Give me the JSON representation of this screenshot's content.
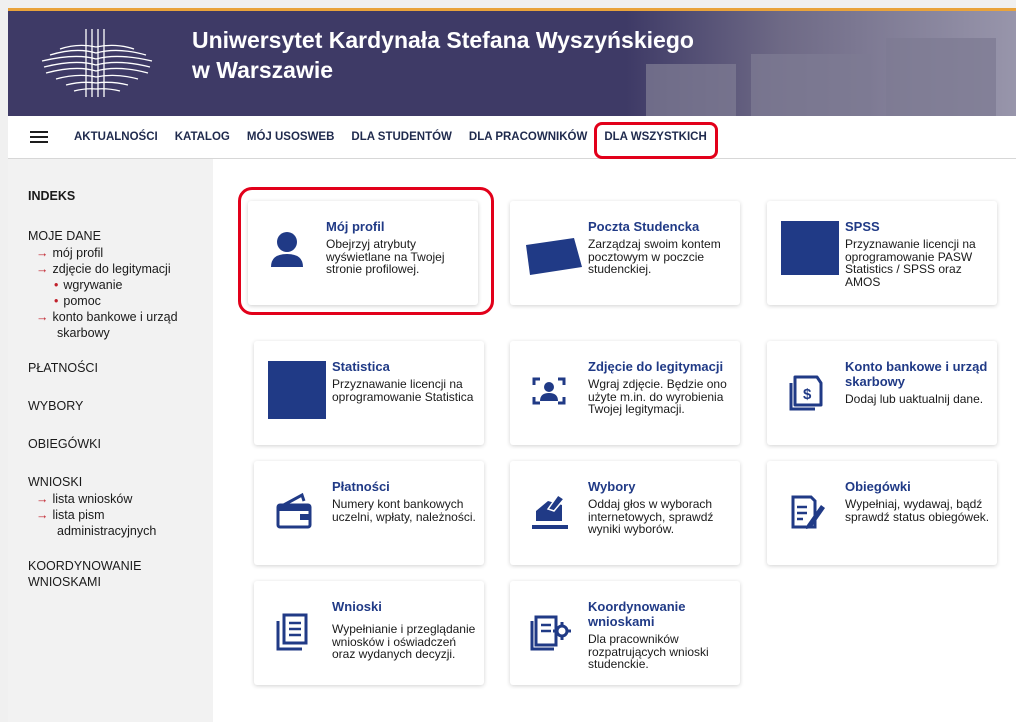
{
  "header": {
    "title": "Uniwersytet Kardynała Stefana Wyszyńskiego w Warszawie",
    "logo_icon": "university-logo-icon",
    "colors": {
      "banner": "#3e3a66",
      "accent": "#e9a33b",
      "highlight": "#e2001a",
      "link": "#203a86"
    }
  },
  "nav": {
    "menu_icon": "hamburger-menu-icon",
    "items": [
      "AKTUALNOŚCI",
      "KATALOG",
      "MÓJ USOSWEB",
      "DLA STUDENTÓW",
      "DLA PRACOWNIKÓW",
      "DLA WSZYSTKICH"
    ],
    "active": "DLA WSZYSTKICH"
  },
  "sidebar": {
    "heading": "INDEKS",
    "moje_dane": {
      "label": "MOJE DANE",
      "links": [
        "mój profil",
        "zdjęcie do legitymacji"
      ],
      "sub": [
        "wgrywanie",
        "pomoc"
      ],
      "konto_line1": "konto bankowe i urząd",
      "konto_line2": "skarbowy"
    },
    "platnosci": "PŁATNOŚCI",
    "wybory": "WYBORY",
    "obiegowki": "OBIEGÓWKI",
    "wnioski": {
      "label": "WNIOSKI",
      "link1": "lista wniosków",
      "link2_line1": "lista pism",
      "link2_line2": "administracyjnych"
    },
    "koordynowanie_line1": "KOORDYNOWANIE",
    "koordynowanie_line2": "WNIOSKAMI"
  },
  "cards": [
    {
      "title": "Mój profil",
      "desc": "Obejrzyj atrybuty wyświetlane na Twojej stronie profilowej.",
      "icon": "user-icon"
    },
    {
      "title": "Poczta Studencka",
      "desc": "Zarządzaj swoim kontem pocztowym w poczcie studenckiej.",
      "icon": "mail-logo-icon"
    },
    {
      "title": "SPSS",
      "desc": "Przyznawanie licencji na oprogramowanie PASW Statistics / SPSS oraz AMOS",
      "icon": "spss-logo-icon"
    },
    {
      "title": "Statistica",
      "desc": "Przyznawanie licencji na oprogramowanie Statistica",
      "icon": "statistica-logo-icon"
    },
    {
      "title": "Zdjęcie do legitymacji",
      "desc": "Wgraj zdjęcie. Będzie ono użyte m.in. do wyrobienia Twojej legitymacji.",
      "icon": "photo-id-icon"
    },
    {
      "title": "Konto bankowe i urząd skarbowy",
      "desc": "Dodaj lub uaktualnij dane.",
      "icon": "bank-document-icon"
    },
    {
      "title": "Płatności",
      "desc": "Numery kont bankowych uczelni, wpłaty, należności.",
      "icon": "wallet-icon"
    },
    {
      "title": "Wybory",
      "desc": "Oddaj głos w wyborach internetowych, sprawdź wyniki wyborów.",
      "icon": "ballot-box-icon"
    },
    {
      "title": "Obiegówki",
      "desc": "Wypełniaj, wydawaj, bądź sprawdź status obiegówek.",
      "icon": "checklist-edit-icon"
    },
    {
      "title": "Wnioski",
      "desc": "Wypełnianie i przeglądanie wniosków i oświadczeń oraz wydanych decyzji.",
      "icon": "form-document-icon"
    },
    {
      "title": "Koordynowanie wnioskami",
      "desc": "Dla pracowników rozpatrujących wnioski studenckie.",
      "icon": "document-gear-icon"
    }
  ]
}
